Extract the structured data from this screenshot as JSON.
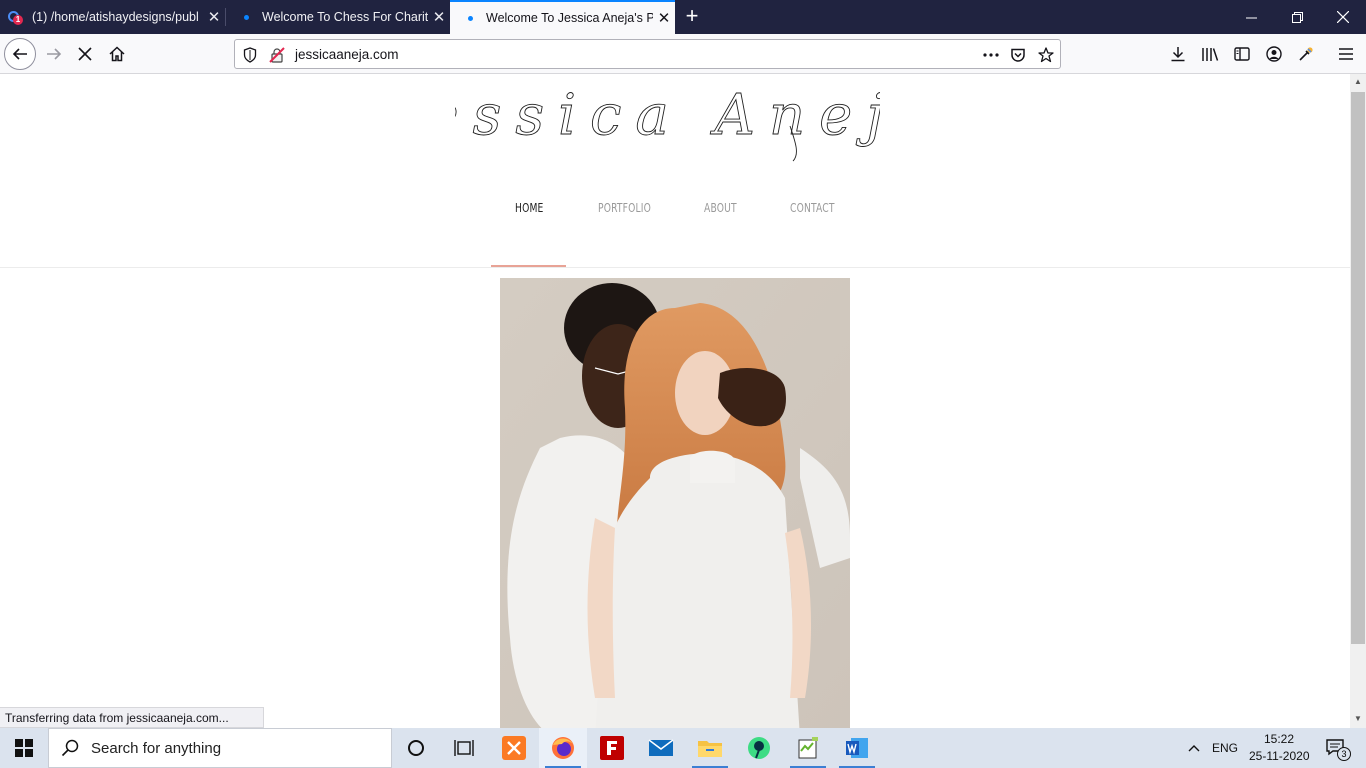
{
  "browser": {
    "tabs": [
      {
        "title": "(1) /home/atishaydesigns/publ",
        "active": false
      },
      {
        "title": "Welcome To Chess For Charity",
        "active": false
      },
      {
        "title": "Welcome To Jessica Aneja's Por",
        "active": true
      }
    ],
    "url": "jessicaaneja.com",
    "status": "Transferring data from jessicaaneja.com...",
    "accent": "#0a84ff"
  },
  "site": {
    "logo_text": "Jessica Aneja",
    "menu": [
      {
        "label": "HOME",
        "active": true
      },
      {
        "label": "PORTFOLIO",
        "active": false
      },
      {
        "label": "ABOUT",
        "active": false
      },
      {
        "label": "CONTACT",
        "active": false
      }
    ],
    "underline_color": "#e8a396"
  },
  "taskbar": {
    "search_placeholder": "Search for anything",
    "language": "ENG",
    "time": "15:22",
    "date": "25-11-2020",
    "notification_count": "3",
    "apps": [
      "task-view",
      "cortana",
      "xampp",
      "firefox",
      "filezilla",
      "mail",
      "file-explorer",
      "android-studio",
      "notepad-plus",
      "word"
    ]
  }
}
